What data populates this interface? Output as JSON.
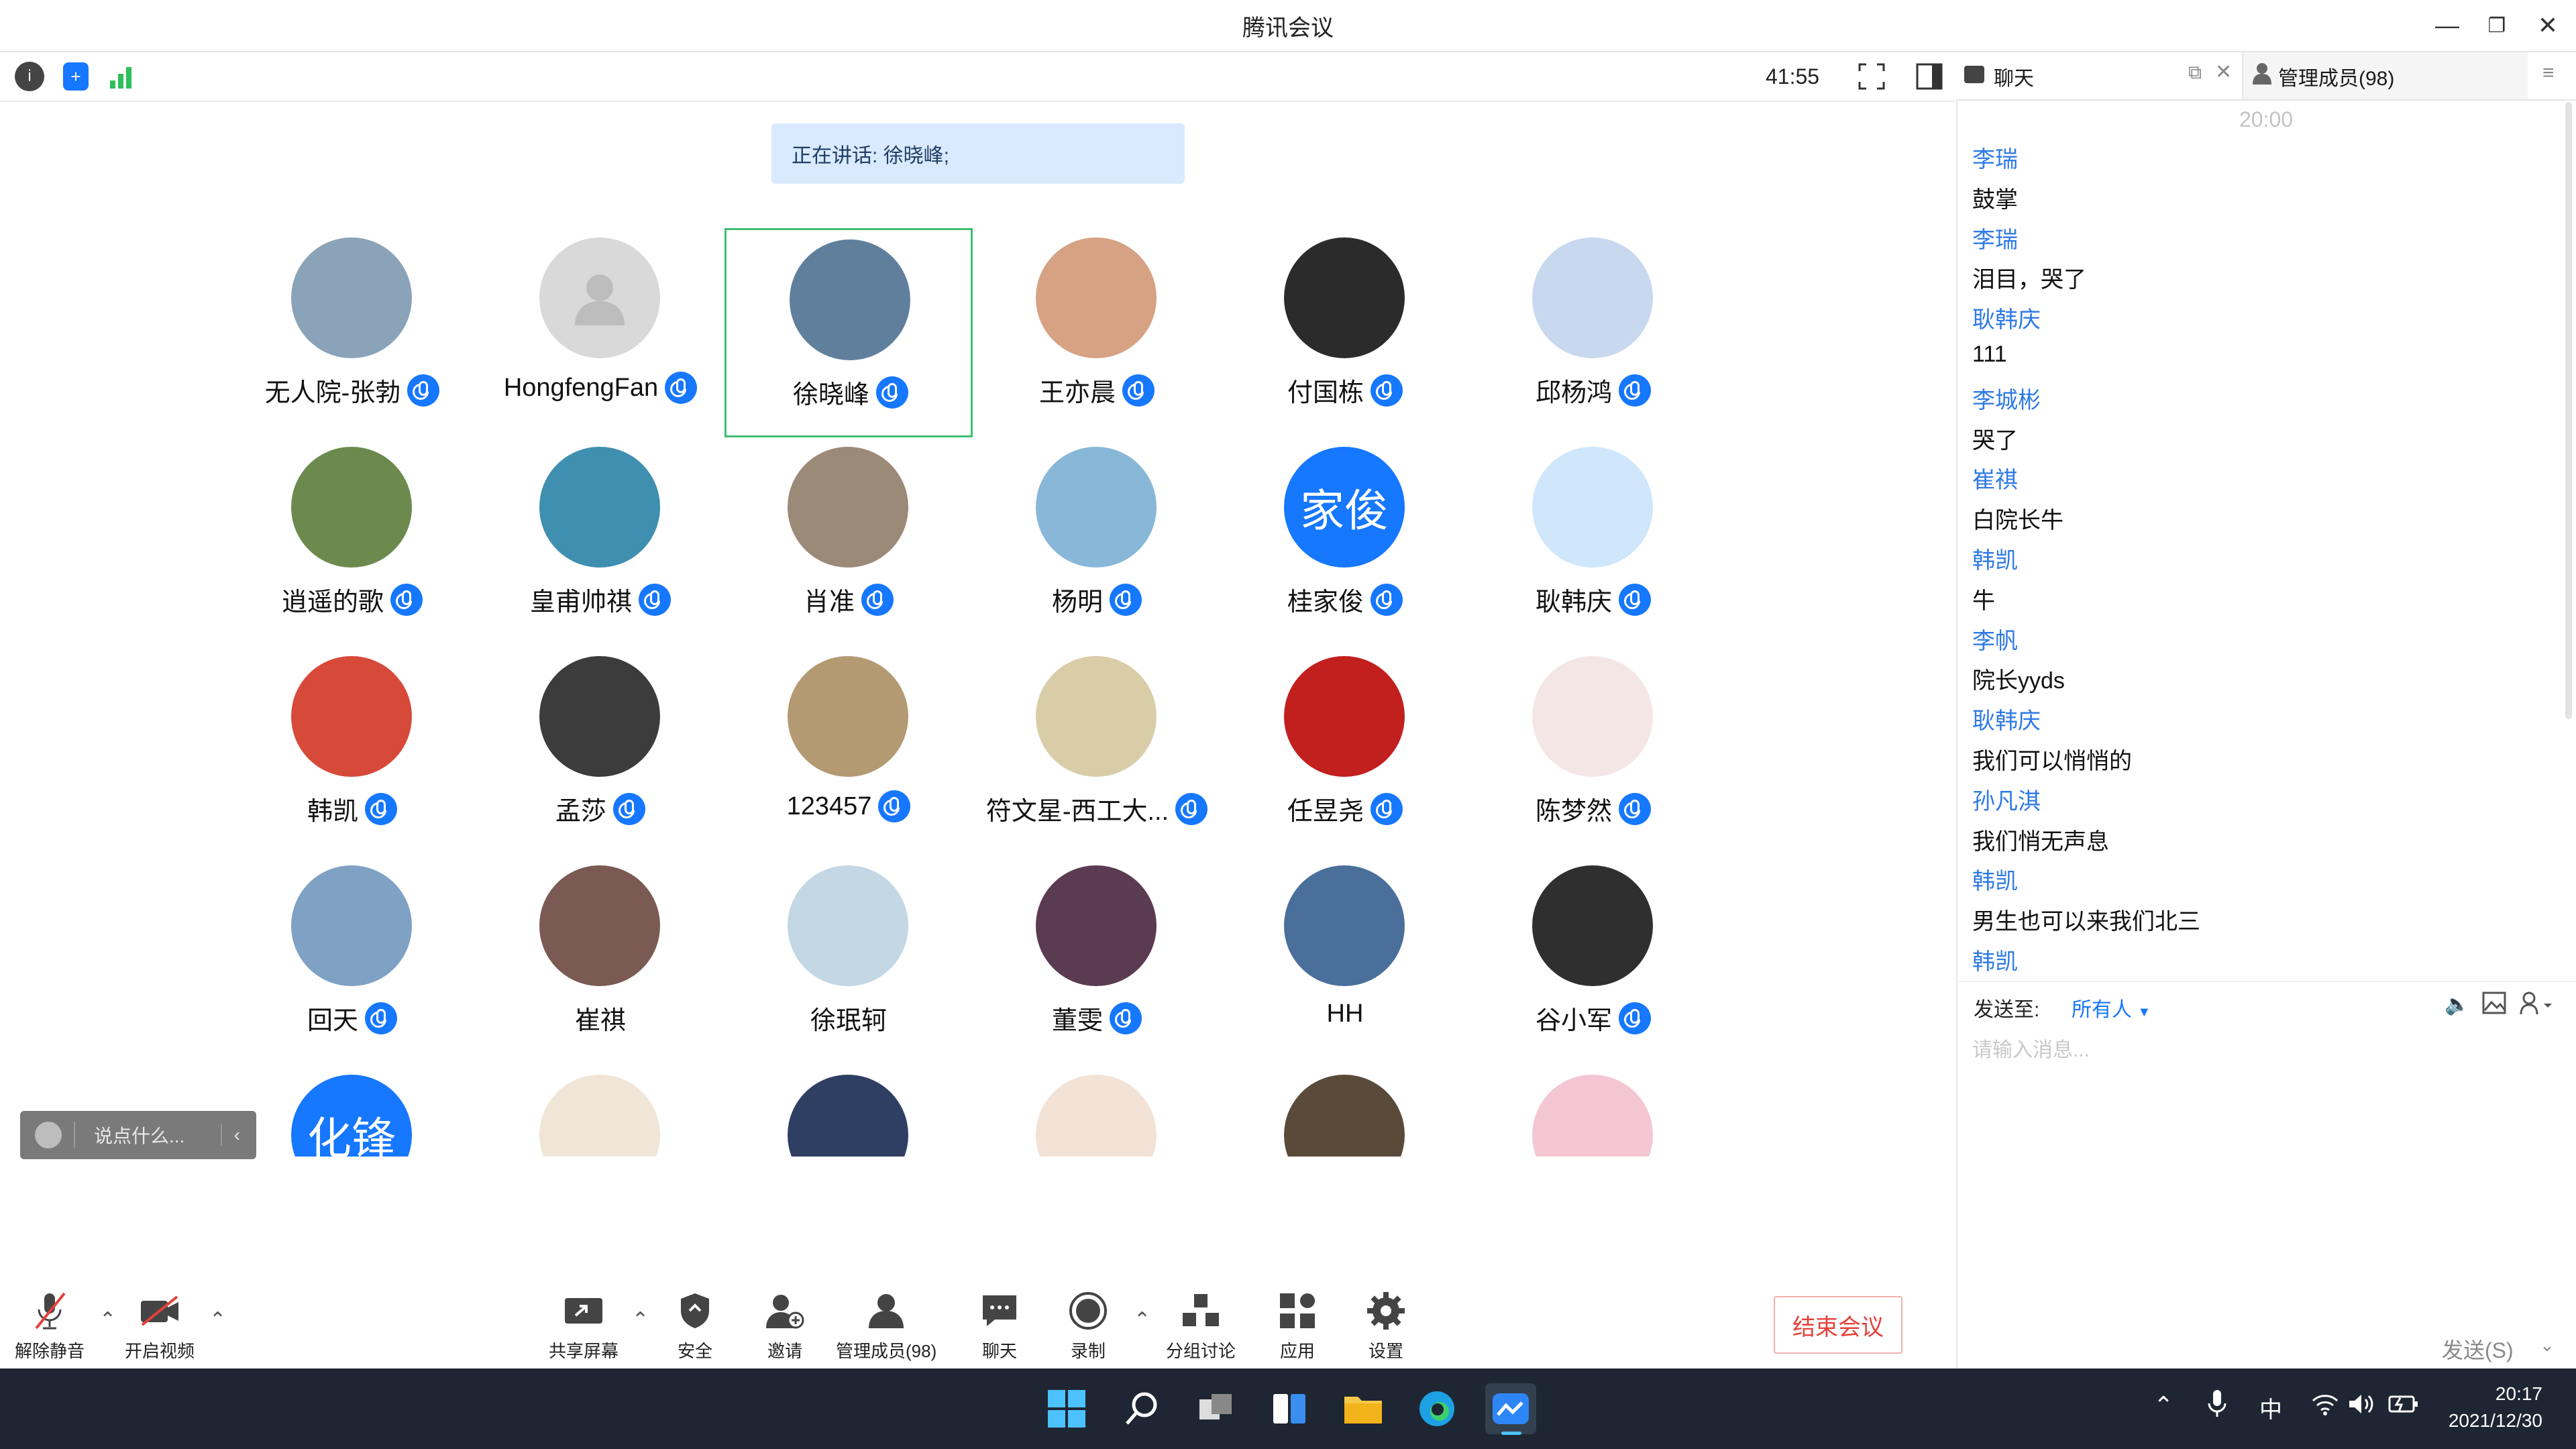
{
  "window": {
    "title": "腾讯会议"
  },
  "topbar": {
    "timer": "41:55"
  },
  "speaking": {
    "text": "正在讲话: 徐晓峰;"
  },
  "participants": [
    {
      "name": "无人院-张勃",
      "mic": true
    },
    {
      "name": "HongfengFan",
      "mic": true
    },
    {
      "name": "徐晓峰",
      "mic": true,
      "active": true
    },
    {
      "name": "王亦晨",
      "mic": true
    },
    {
      "name": "付国栋",
      "mic": true
    },
    {
      "name": "邱杨鸿",
      "mic": true
    },
    {
      "name": "逍遥的歌",
      "mic": true
    },
    {
      "name": "皇甫帅祺",
      "mic": true
    },
    {
      "name": "肖准",
      "mic": true
    },
    {
      "name": "杨明",
      "mic": true
    },
    {
      "name": "桂家俊",
      "mic": true,
      "avatar_text": "家俊"
    },
    {
      "name": "耿韩庆",
      "mic": true
    },
    {
      "name": "韩凯",
      "mic": true
    },
    {
      "name": "孟莎",
      "mic": true
    },
    {
      "name": "123457",
      "mic": true
    },
    {
      "name": "符文星-西工大...",
      "mic": true
    },
    {
      "name": "任昱尧",
      "mic": true
    },
    {
      "name": "陈梦然",
      "mic": true
    },
    {
      "name": "回天",
      "mic": true
    },
    {
      "name": "崔祺",
      "mic": false
    },
    {
      "name": "徐珉轲",
      "mic": false
    },
    {
      "name": "董雯",
      "mic": true
    },
    {
      "name": "HH",
      "mic": false
    },
    {
      "name": "谷小军",
      "mic": true
    },
    {
      "name": "",
      "avatar_text": "化锋"
    },
    {
      "name": ""
    },
    {
      "name": ""
    },
    {
      "name": ""
    },
    {
      "name": ""
    },
    {
      "name": ""
    }
  ],
  "saybox": {
    "placeholder": "说点什么..."
  },
  "toolbar": {
    "unmute": "解除静音",
    "video": "开启视频",
    "share": "共享屏幕",
    "security": "安全",
    "invite": "邀请",
    "members": "管理成员(98)",
    "chat": "聊天",
    "record": "录制",
    "breakout": "分组讨论",
    "apps": "应用",
    "settings": "设置",
    "end": "结束会议"
  },
  "chat_panel": {
    "tab_chat": "聊天",
    "tab_members": "管理成员(98)",
    "time": "20:00",
    "messages": [
      {
        "type": "name",
        "text": "李瑞"
      },
      {
        "type": "msg",
        "text": "鼓掌"
      },
      {
        "type": "name",
        "text": "李瑞"
      },
      {
        "type": "msg",
        "text": "泪目，哭了"
      },
      {
        "type": "name",
        "text": "耿韩庆"
      },
      {
        "type": "msg",
        "text": "111"
      },
      {
        "type": "name",
        "text": "李城彬"
      },
      {
        "type": "msg",
        "text": "哭了"
      },
      {
        "type": "name",
        "text": "崔祺"
      },
      {
        "type": "msg",
        "text": "白院长牛"
      },
      {
        "type": "name",
        "text": "韩凯"
      },
      {
        "type": "msg",
        "text": "牛"
      },
      {
        "type": "name",
        "text": "李帆"
      },
      {
        "type": "msg",
        "text": "院长yyds"
      },
      {
        "type": "name",
        "text": "耿韩庆"
      },
      {
        "type": "msg",
        "text": "我们可以悄悄的"
      },
      {
        "type": "name",
        "text": "孙凡淇"
      },
      {
        "type": "msg",
        "text": "我们悄无声息"
      },
      {
        "type": "name",
        "text": "韩凯"
      },
      {
        "type": "msg",
        "text": "男生也可以来我们北三"
      },
      {
        "type": "name",
        "text": "韩凯"
      }
    ],
    "send_to_label": "发送至:",
    "send_to_value": "所有人",
    "input_placeholder": "请输入消息...",
    "send_button": "发送(S)"
  },
  "taskbar": {
    "time": "20:17",
    "date": "2021/12/30",
    "ime": "中"
  },
  "colors": {
    "accent": "#1677ff",
    "end_red": "#e5403a",
    "taskbar": "#1e2633"
  }
}
